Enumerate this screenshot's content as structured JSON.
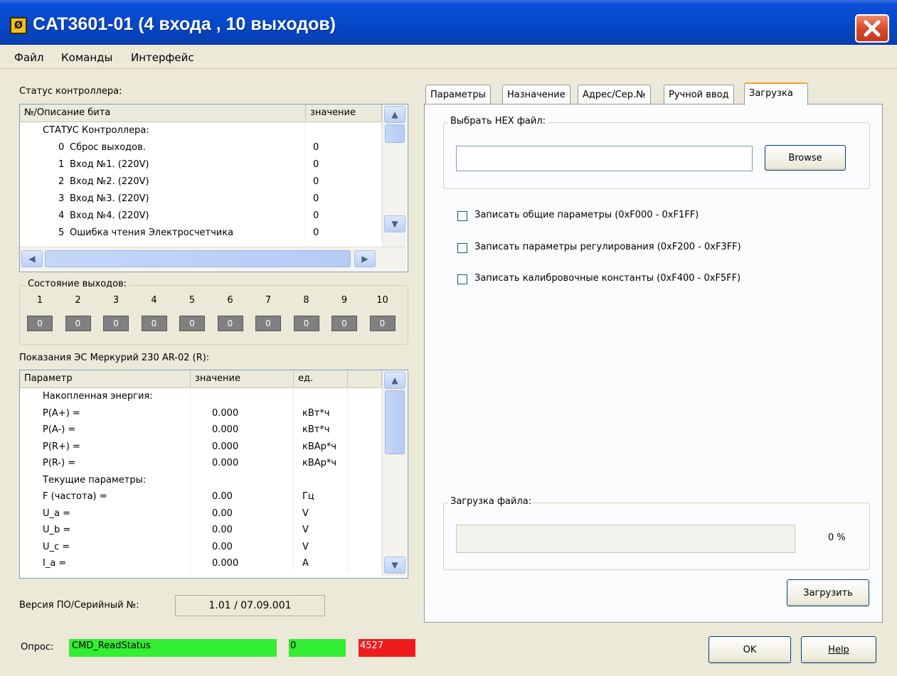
{
  "window": {
    "title": "CAT3601-01 (4 входа , 10 выходов)",
    "app_icon_glyph": "Ø"
  },
  "menu": [
    "Файл",
    "Команды",
    "Интерфейс"
  ],
  "status": {
    "label": "Статус контроллера:",
    "columns": [
      "№/Описание бита",
      "значение"
    ],
    "rows": [
      {
        "num": "",
        "desc": "СТАТУС Контроллера:",
        "value": ""
      },
      {
        "num": "0",
        "desc": "Сброс выходов.",
        "value": "0"
      },
      {
        "num": "1",
        "desc": "Вход №1. (220V)",
        "value": "0"
      },
      {
        "num": "2",
        "desc": "Вход №2. (220V)",
        "value": "0"
      },
      {
        "num": "3",
        "desc": "Вход №3. (220V)",
        "value": "0"
      },
      {
        "num": "4",
        "desc": "Вход №4. (220V)",
        "value": "0"
      },
      {
        "num": "5",
        "desc": "Ошибка чтения Электросчетчика",
        "value": "0"
      }
    ]
  },
  "outputs": {
    "label": "Состояние выходов:",
    "numbers": [
      "1",
      "2",
      "3",
      "4",
      "5",
      "6",
      "7",
      "8",
      "9",
      "10"
    ],
    "values": [
      "0",
      "0",
      "0",
      "0",
      "0",
      "0",
      "0",
      "0",
      "0",
      "0"
    ]
  },
  "meter": {
    "label": "Показания ЭС Меркурий 230 AR-02 (R):",
    "columns": [
      "Параметр",
      "значение",
      "ед."
    ],
    "rows": [
      {
        "param": "Накопленная энергия:",
        "value": "",
        "unit": "",
        "group": true
      },
      {
        "param": "P(A+) =",
        "value": "0.000",
        "unit": "кВт*ч"
      },
      {
        "param": "P(A-) =",
        "value": "0.000",
        "unit": "кВт*ч"
      },
      {
        "param": "P(R+) =",
        "value": "0.000",
        "unit": "кВАр*ч"
      },
      {
        "param": "P(R-) =",
        "value": "0.000",
        "unit": "кВАр*ч"
      },
      {
        "param": "Текущие параметры:",
        "value": "",
        "unit": "",
        "group": true
      },
      {
        "param": "F (частота) =",
        "value": "0.00",
        "unit": "Гц"
      },
      {
        "param": "U_a =",
        "value": "0.00",
        "unit": "V"
      },
      {
        "param": "U_b =",
        "value": "0.00",
        "unit": "V"
      },
      {
        "param": "U_c =",
        "value": "0.00",
        "unit": "V"
      },
      {
        "param": "I_a =",
        "value": "0.000",
        "unit": "A"
      }
    ]
  },
  "version": {
    "label": "Версия ПО/Серийный №:",
    "value": "1.01 / 07.09.001"
  },
  "poll": {
    "label": "Опрос:",
    "command": "CMD_ReadStatus",
    "counter": "0",
    "error_count": "4527"
  },
  "tabs": [
    "Параметры",
    "Назначение",
    "Адрес/Сер.№",
    "Ручной ввод",
    "Загрузка"
  ],
  "active_tab": "Загрузка",
  "upload": {
    "hex_group_label": "Выбрать HEX файл:",
    "hex_path": "",
    "browse_label": "Browse",
    "checkboxes": [
      {
        "label": "Записать общие параметры (0xF000 - 0xF1FF)",
        "checked": false
      },
      {
        "label": "Записать параметры регулирования (0xF200 - 0xF3FF)",
        "checked": false
      },
      {
        "label": "Записать калибровочные константы (0xF400 - 0xF5FF)",
        "checked": false
      }
    ],
    "progress_group_label": "Загрузка файла:",
    "progress_text": "0 %",
    "progress_fraction": 0,
    "upload_button": "Загрузить"
  },
  "buttons": {
    "ok": "OK",
    "help": "Help"
  },
  "colors": {
    "title_bar": "#0547c7",
    "poll_ok": "#33ee33",
    "poll_error": "#ee1c1c",
    "output_box": "#808080"
  }
}
